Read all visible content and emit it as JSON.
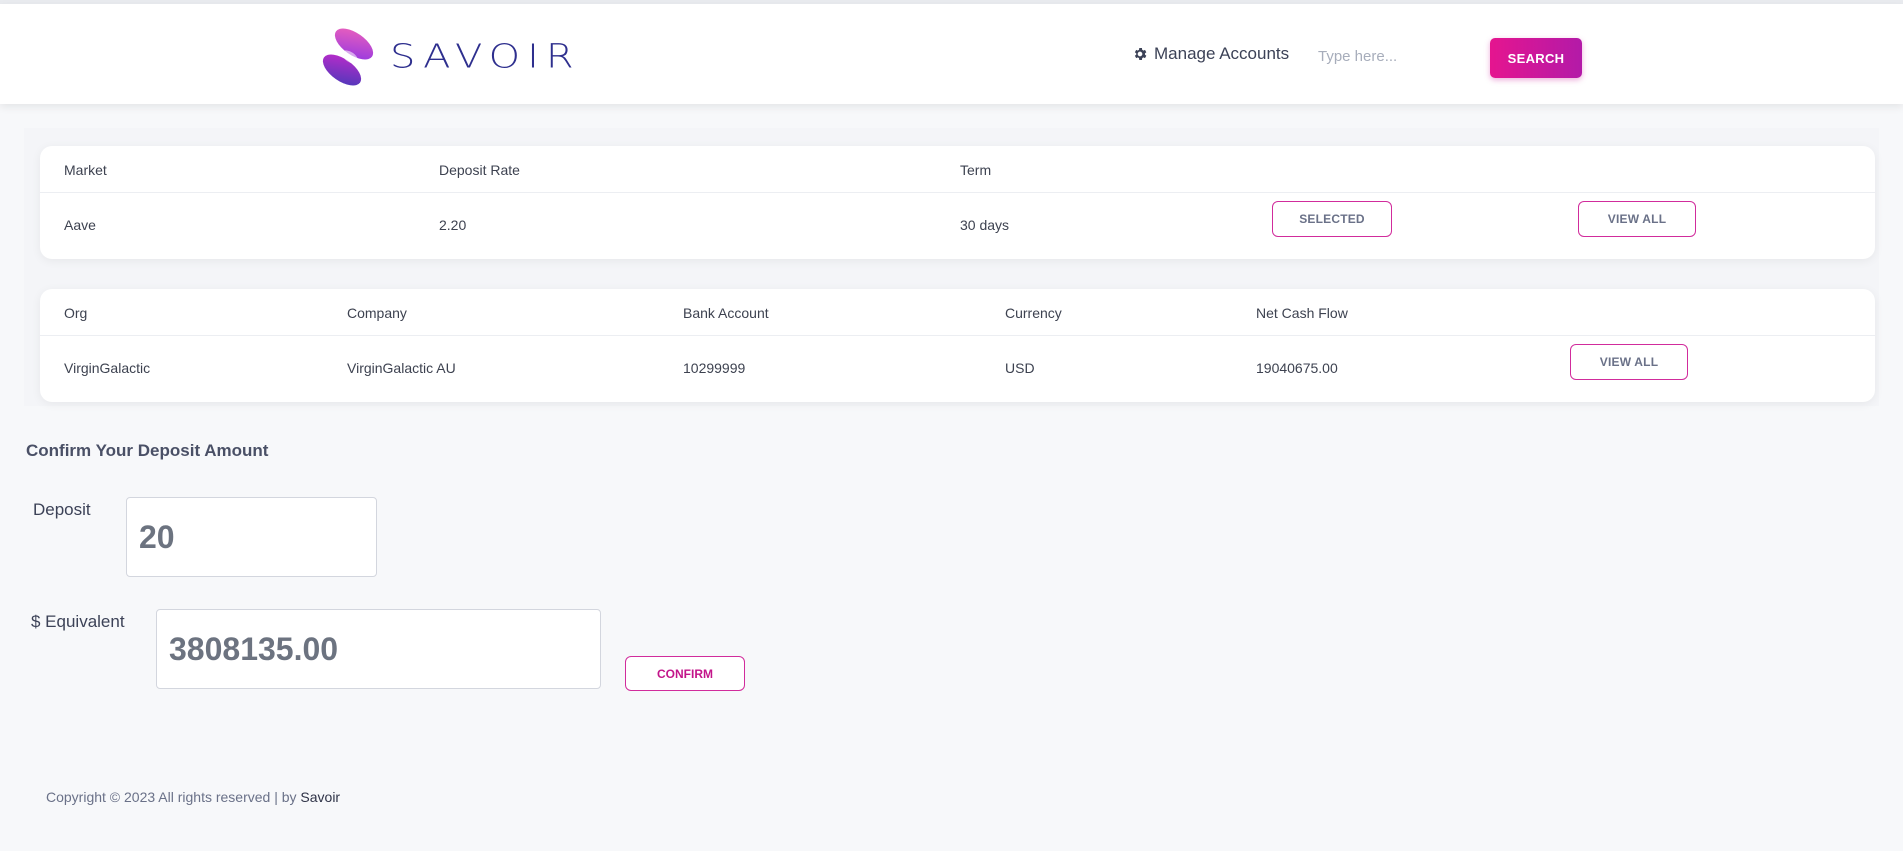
{
  "header": {
    "logo_text": "SAVOIR",
    "manage_accounts": "Manage Accounts",
    "search_placeholder": "Type here...",
    "search_button": "SEARCH"
  },
  "market_table": {
    "headers": [
      "Market",
      "Deposit Rate",
      "Term"
    ],
    "row": [
      "Aave",
      "2.20",
      "30 days"
    ],
    "selected_button": "SELECTED",
    "view_all_button": "VIEW ALL"
  },
  "account_table": {
    "headers": [
      "Org",
      "Company",
      "Bank Account",
      "Currency",
      "Net Cash Flow"
    ],
    "row": [
      "VirginGalactic",
      "VirginGalactic AU",
      "10299999",
      "USD",
      "19040675.00"
    ],
    "view_all_button": "VIEW ALL"
  },
  "deposit_form": {
    "title": "Confirm Your Deposit Amount",
    "deposit_label": "Deposit",
    "deposit_value": "20",
    "equivalent_label": "$ Equivalent",
    "equivalent_value": "3808135.00",
    "confirm_button": "CONFIRM"
  },
  "footer": {
    "copyright": "Copyright © 2023 All rights reserved | by ",
    "brand": "Savoir"
  },
  "colors": {
    "accent": "#e5158f",
    "accent_secondary": "#b31aa8",
    "logo_blue": "#2e2f8e"
  },
  "icons": [
    "logo-mark-icon",
    "gear-icon"
  ]
}
